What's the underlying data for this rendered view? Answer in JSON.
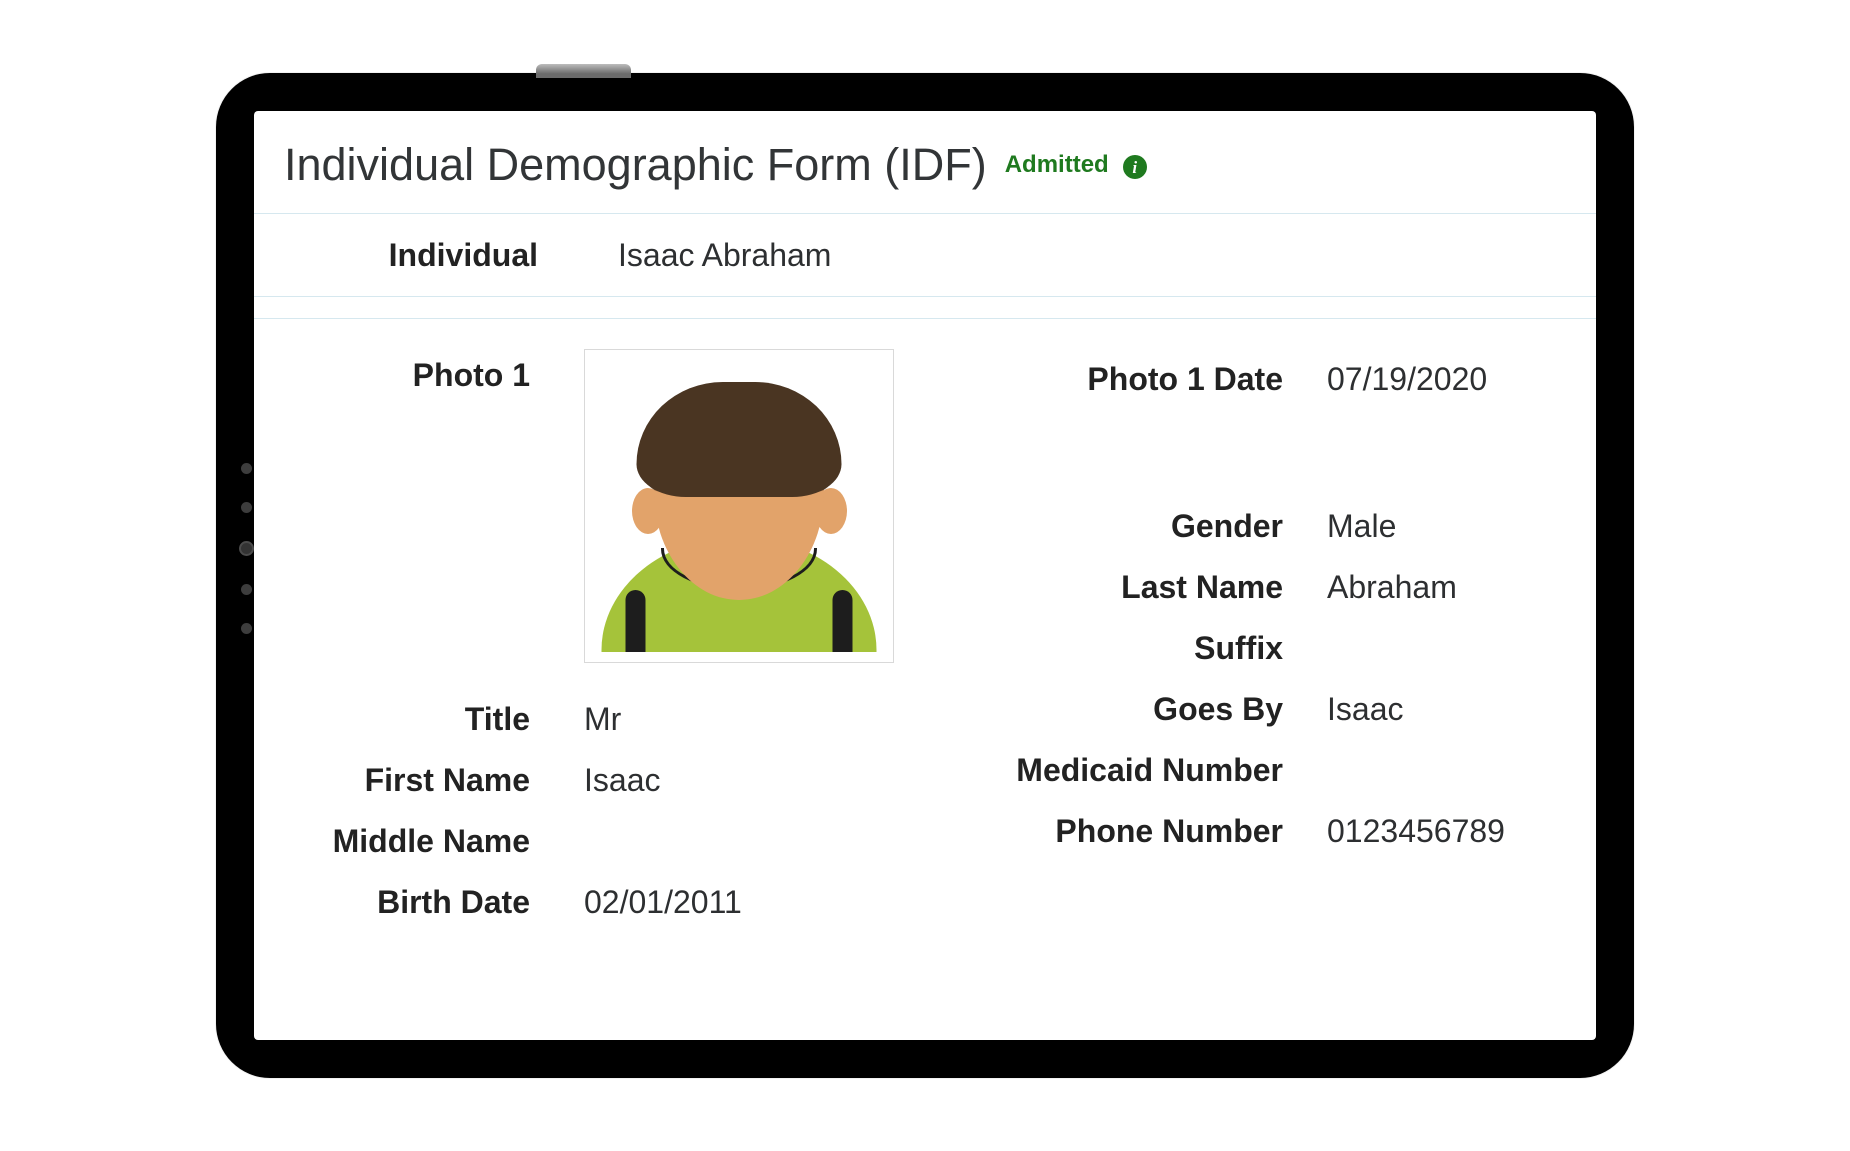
{
  "header": {
    "title": "Individual Demographic Form (IDF)",
    "status": "Admitted"
  },
  "individual": {
    "label": "Individual",
    "name": "Isaac Abraham"
  },
  "left_fields": {
    "photo1_label": "Photo 1",
    "title_label": "Title",
    "title_value": "Mr",
    "first_name_label": "First Name",
    "first_name_value": "Isaac",
    "middle_name_label": "Middle Name",
    "middle_name_value": "",
    "birth_date_label": "Birth Date",
    "birth_date_value": "02/01/2011"
  },
  "right_fields": {
    "photo1_date_label": "Photo 1 Date",
    "photo1_date_value": "07/19/2020",
    "gender_label": "Gender",
    "gender_value": "Male",
    "last_name_label": "Last Name",
    "last_name_value": "Abraham",
    "suffix_label": "Suffix",
    "suffix_value": "",
    "goes_by_label": "Goes By",
    "goes_by_value": "Isaac",
    "medicaid_label": "Medicaid Number",
    "medicaid_value": "",
    "phone_label": "Phone Number",
    "phone_value": "0123456789"
  }
}
